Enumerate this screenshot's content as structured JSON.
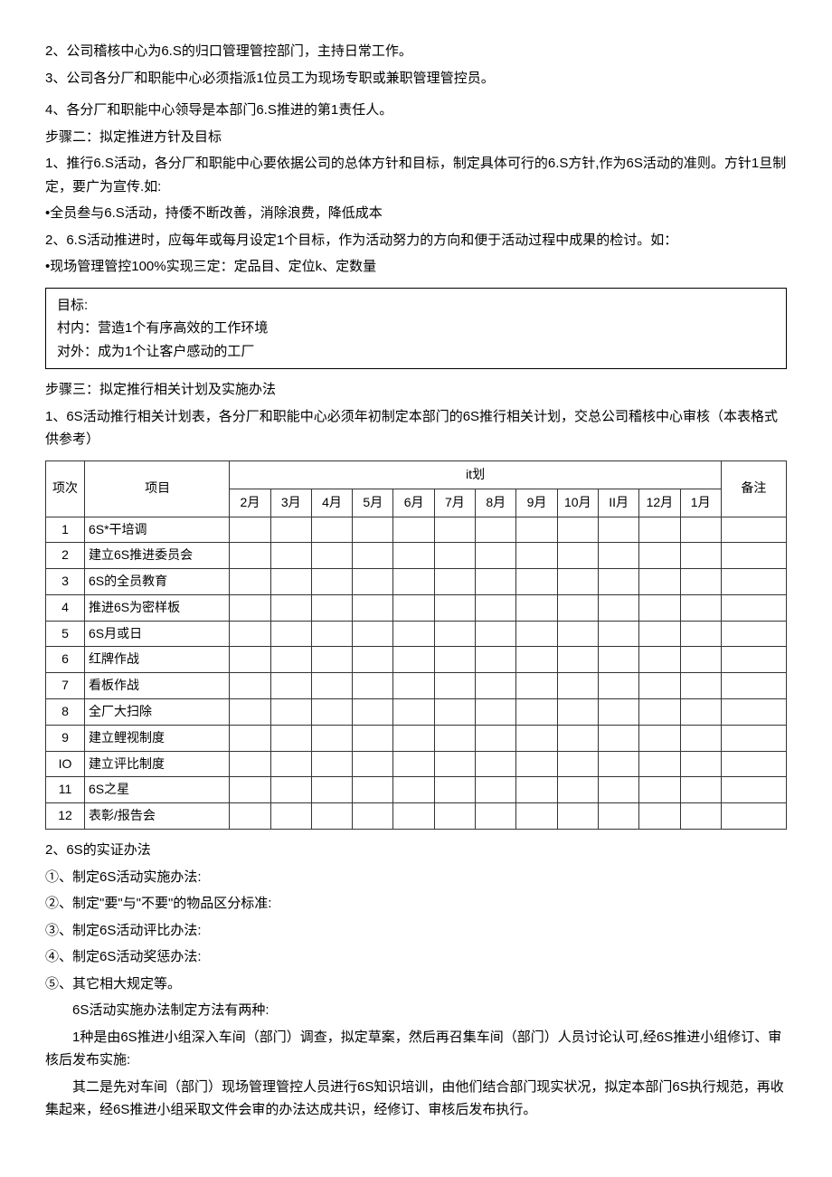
{
  "paras": {
    "p1": "2、公司稽核中心为6.S的归口管理管控部门，主持日常工作。",
    "p2": "3、公司各分厂和职能中心必须指派1位员工为现场专职或兼职管理管控员。",
    "p3": "4、各分厂和职能中心领导是本部门6.S推进的第1责任人。",
    "p4": "步骤二：拟定推进方针及目标",
    "p5": "1、推行6.S活动，各分厂和职能中心要依据公司的总体方针和目标，制定具体可行的6.S方针,作为6S活动的准则。方针1旦制定，要广为宣传.如:",
    "p6": "•全员叁与6.S活动，持倭不断改善，消除浪费，降低成本",
    "p7": "2、6.S活动推进时，应每年或每月设定1个目标，作为活动努力的方向和便于活动过程中成果的检讨。如：",
    "p8": "•现场管理管控100%实现三定：定品目、定位k、定数量"
  },
  "box": {
    "l1": "目标:",
    "l2": "村内：营造1个有序高效的工作环境",
    "l3": "对外：成为1个让客户感动的工厂"
  },
  "paras2": {
    "s1": "步骤三：拟定推行相关计划及实施办法",
    "s2": "1、6S活动推行相关计划表，各分厂和职能中心必须年初制定本部门的6S推行相关计划，交总公司稽核中心审核（本表格式供参考）"
  },
  "table": {
    "h_seq": "项次",
    "h_item": "项目",
    "h_plan": "it划",
    "h_remark": "备注",
    "months": [
      "2月",
      "3月",
      "4月",
      "5月",
      "6月",
      "7月",
      "8月",
      "9月",
      "10月",
      "II月",
      "12月",
      "1月"
    ],
    "rows": [
      {
        "n": "1",
        "item": "6S*干培调"
      },
      {
        "n": "2",
        "item": "建立6S推进委员会"
      },
      {
        "n": "3",
        "item": "6S的全员教育"
      },
      {
        "n": "4",
        "item": "推进6S为密样板"
      },
      {
        "n": "5",
        "item": "6S月或日"
      },
      {
        "n": "6",
        "item": "红牌作战"
      },
      {
        "n": "7",
        "item": "看板作战"
      },
      {
        "n": "8",
        "item": "全厂大扫除"
      },
      {
        "n": "9",
        "item": "建立鲤视制度"
      },
      {
        "n": "IO",
        "item": "建立评比制度"
      },
      {
        "n": "11",
        "item": "6S之星"
      },
      {
        "n": "12",
        "item": "表彰/报告会"
      }
    ]
  },
  "paras3": {
    "t1": "2、6S的实证办法",
    "t2": "①、制定6S活动实施办法:",
    "t3": "②、制定\"要\"与\"不要\"的物品区分标准:",
    "t4": "③、制定6S活动评比办法:",
    "t5": "④、制定6S活动奖惩办法:",
    "t6": "⑤、其它相大规定等。",
    "t7": "6S活动实施办法制定方法有两种:",
    "t8": "1种是由6S推进小组深入车间（部门）调查，拟定草案，然后再召集车间（部门）人员讨论认可,经6S推进小组修订、审核后发布实施:",
    "t9": "其二是先对车间（部门）现场管理管控人员进行6S知识培训，由他们结合部门现实状况，拟定本部门6S执行规范，再收集起来，经6S推进小组采取文件会审的办法达成共识，经修订、审核后发布执行。"
  }
}
